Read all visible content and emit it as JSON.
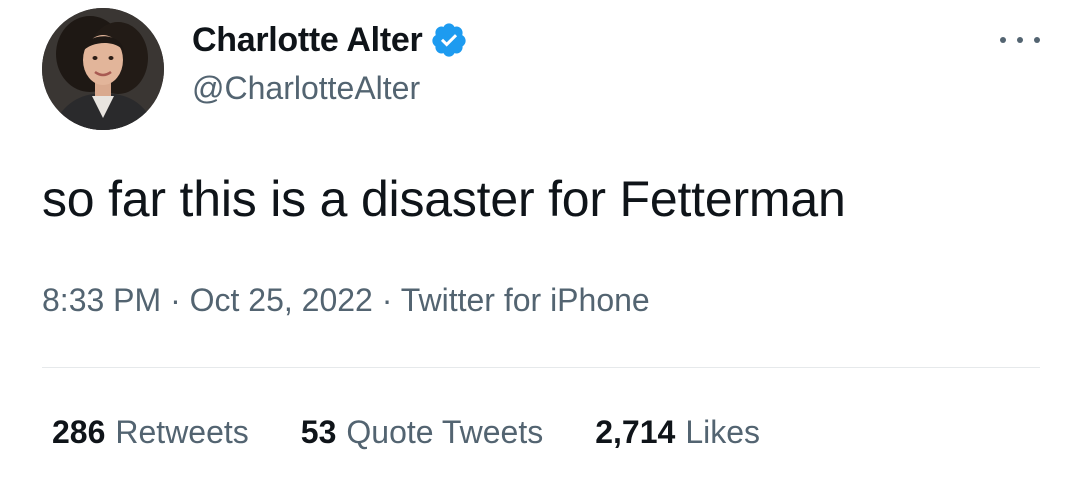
{
  "author": {
    "display_name": "Charlotte Alter",
    "handle": "@CharlotteAlter",
    "avatar_icon": "profile-photo",
    "verified_icon": "verified-badge-icon",
    "verified_color": "#1d9bf0"
  },
  "tweet": {
    "text": "so far this is a disaster for Fetterman",
    "time": "8:33 PM",
    "date": "Oct 25, 2022",
    "separator": "·",
    "source": "Twitter for iPhone"
  },
  "stats": {
    "retweets_count": "286",
    "retweets_label": "Retweets",
    "quotes_count": "53",
    "quotes_label": "Quote Tweets",
    "likes_count": "2,714",
    "likes_label": "Likes"
  },
  "menu": {
    "more_icon": "more-options-icon"
  },
  "colors": {
    "text_primary": "#0f1419",
    "text_secondary": "#536471",
    "divider": "#e6e9eb"
  }
}
